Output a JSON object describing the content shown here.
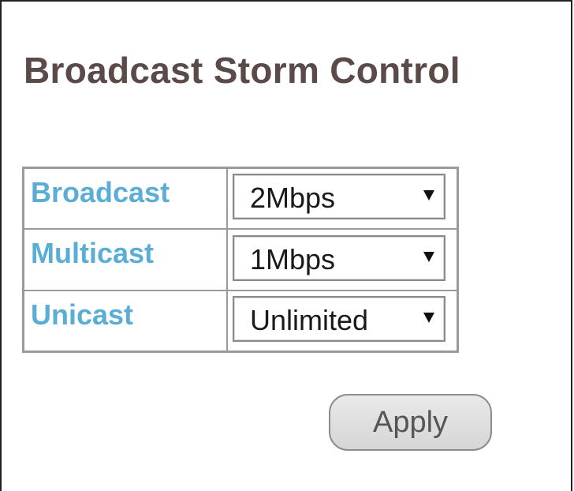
{
  "page": {
    "title": "Broadcast Storm Control"
  },
  "settings": {
    "rows": [
      {
        "label": "Broadcast",
        "value": "2Mbps"
      },
      {
        "label": "Multicast",
        "value": "1Mbps"
      },
      {
        "label": "Unicast",
        "value": "Unlimited"
      }
    ]
  },
  "actions": {
    "apply_label": "Apply"
  },
  "colors": {
    "title": "#5a4a48",
    "label": "#5aaed6",
    "border": "#9a9a9a",
    "button_bg": "#dddddd"
  },
  "icons": {
    "dropdown": "caret-down-icon"
  }
}
